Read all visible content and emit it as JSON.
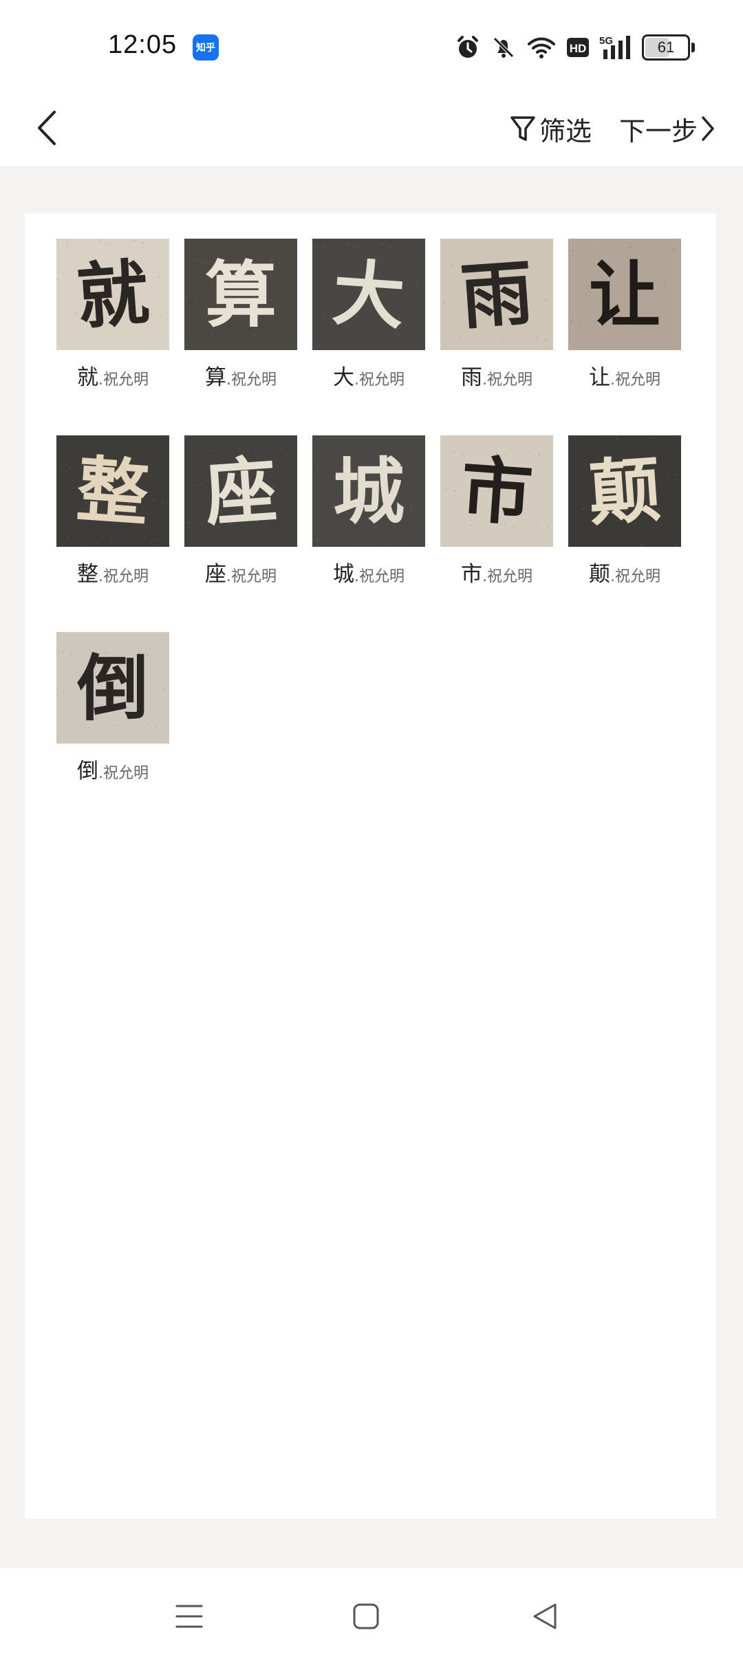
{
  "status_bar": {
    "time": "12:05",
    "app_badge": "知乎",
    "battery": "61",
    "battery_level": 0.61,
    "icons": [
      "alarm-icon",
      "mute-bell-icon",
      "wifi-icon",
      "hd-icon",
      "5g-signal-icon",
      "battery-icon"
    ],
    "network_label": "5G",
    "hd_label": "HD"
  },
  "header": {
    "filter_label": "筛选",
    "next_label": "下一步"
  },
  "items": [
    {
      "char": "就",
      "author": ".祝允明",
      "bg": "#d8d1c4",
      "ink": "#2a2623"
    },
    {
      "char": "算",
      "author": ".祝允明",
      "bg": "#4b4844",
      "ink": "#e8e2d6"
    },
    {
      "char": "大",
      "author": ".祝允明",
      "bg": "#494744",
      "ink": "#e4dfd3"
    },
    {
      "char": "雨",
      "author": ".祝允明",
      "bg": "#cfc5b6",
      "ink": "#2b2724"
    },
    {
      "char": "让",
      "author": ".祝允明",
      "bg": "#b2a597",
      "ink": "#1e1b19"
    },
    {
      "char": "整",
      "author": ".祝允明",
      "bg": "#3e3c39",
      "ink": "#e4d6bd"
    },
    {
      "char": "座",
      "author": ".祝允明",
      "bg": "#43413e",
      "ink": "#e6e0d3"
    },
    {
      "char": "城",
      "author": ".祝允明",
      "bg": "#4a4845",
      "ink": "#e3ddd0"
    },
    {
      "char": "市",
      "author": ".祝允明",
      "bg": "#d3cbbe",
      "ink": "#221f1c"
    },
    {
      "char": "颠",
      "author": ".祝允明",
      "bg": "#3b3a37",
      "ink": "#e6dcc6"
    },
    {
      "char": "倒",
      "author": ".祝允明",
      "bg": "#cdc7bd",
      "ink": "#2a2623"
    }
  ]
}
